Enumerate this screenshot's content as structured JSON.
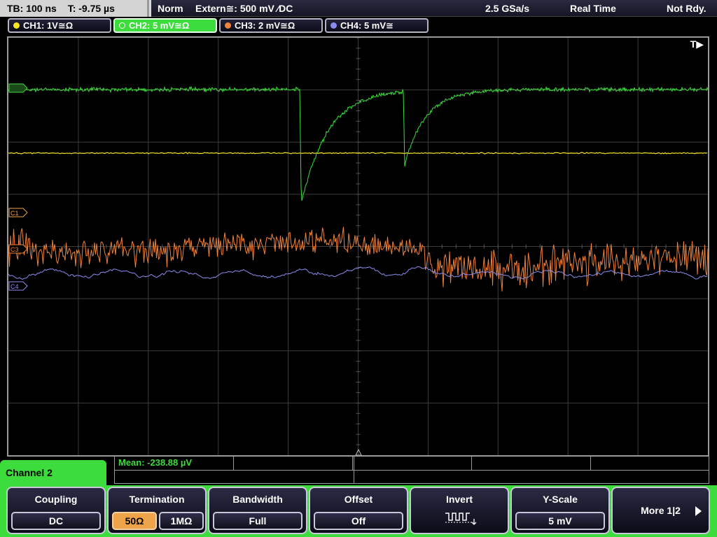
{
  "status": {
    "timebase": "TB: 100 ns",
    "trigger_time": "T: -9.75 µs",
    "trigger_mode": "Norm",
    "trigger_source": "Extern≅: 500 mV ⁄DC",
    "sample_rate": "2.5 GSa/s",
    "acq_mode": "Real Time",
    "state": "Not Rdy."
  },
  "channels": [
    {
      "label": "CH1: 1V≅Ω",
      "color": "#f5e61e",
      "active": false
    },
    {
      "label": "CH2: 5 mV≅Ω",
      "color": "#3ddc3d",
      "active": true
    },
    {
      "label": "CH3: 2 mV≅Ω",
      "color": "#f0823a",
      "active": false
    },
    {
      "label": "CH4: 5 mV≅",
      "color": "#8c8cf0",
      "active": false
    }
  ],
  "display": {
    "trigger_marker": "T▶",
    "ch_markers": [
      "C1",
      "C3",
      "C4"
    ]
  },
  "measurement": {
    "text": "Mean: -238.88 µV"
  },
  "menu": {
    "title": "Channel 2",
    "coupling": {
      "title": "Coupling",
      "value": "DC"
    },
    "termination": {
      "title": "Termination",
      "options": [
        "50Ω",
        "1MΩ"
      ],
      "selected": "50Ω"
    },
    "bandwidth": {
      "title": "Bandwidth",
      "value": "Full"
    },
    "offset": {
      "title": "Offset",
      "value": "Off"
    },
    "invert": {
      "title": "Invert"
    },
    "yscale": {
      "title": "Y-Scale",
      "value": "5 mV"
    },
    "more": {
      "label": "More 1|2"
    }
  },
  "colors": {
    "ch1": "#f5e61e",
    "ch2": "#3ddc3d",
    "ch3": "#f0823a",
    "ch4": "#8c8cf0",
    "menu_accent": "#3ddc3d",
    "selected_option": "#f0a44a"
  }
}
